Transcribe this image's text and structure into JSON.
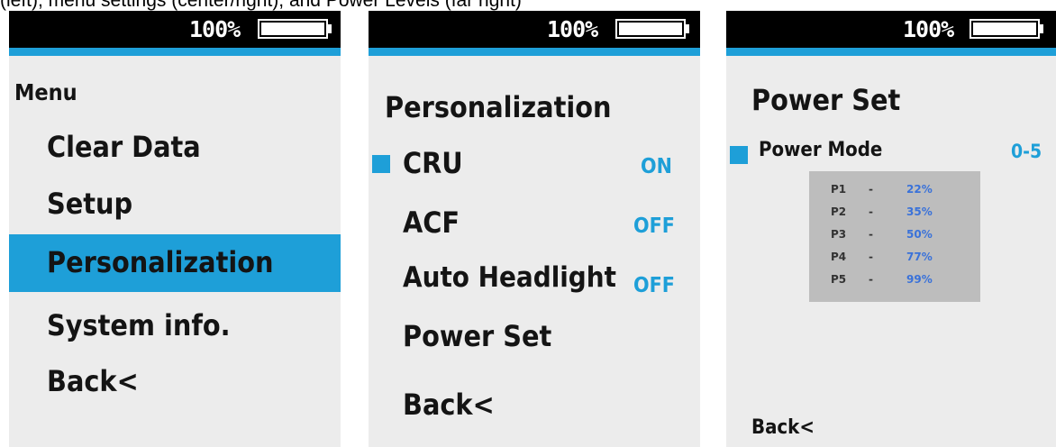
{
  "caption": "(left), menu settings (center/right), and Power Levels (far right)",
  "status": {
    "battery_text": "100%",
    "battery_level_pct": 100
  },
  "screen1": {
    "title": "Menu",
    "items": [
      {
        "label": "Clear Data",
        "selected": false
      },
      {
        "label": "Setup",
        "selected": false
      },
      {
        "label": "Personalization",
        "selected": true
      },
      {
        "label": "System info.",
        "selected": false
      },
      {
        "label": "Back<",
        "selected": false
      }
    ]
  },
  "screen2": {
    "title": "Personalization",
    "items": [
      {
        "label": "CRU",
        "value": "ON",
        "active": true
      },
      {
        "label": "ACF",
        "value": "OFF",
        "active": false
      },
      {
        "label": "Auto Headlight",
        "value": "OFF",
        "active": false
      },
      {
        "label": "Power Set",
        "value": "",
        "active": false
      },
      {
        "label": "Back<",
        "value": "",
        "active": false
      }
    ]
  },
  "screen3": {
    "title": "Power Set",
    "mode_label": "Power Mode",
    "mode_value": "0-5",
    "levels": [
      {
        "level": "P1",
        "dash": "-",
        "percent": "22%"
      },
      {
        "level": "P2",
        "dash": "-",
        "percent": "35%"
      },
      {
        "level": "P3",
        "dash": "-",
        "percent": "50%"
      },
      {
        "level": "P4",
        "dash": "-",
        "percent": "77%"
      },
      {
        "level": "P5",
        "dash": "-",
        "percent": "99%"
      }
    ],
    "back_label": "Back<"
  },
  "colors": {
    "accent": "#1e9fd8",
    "screen_bg": "#ececec",
    "statusbar": "#000000",
    "table_bg": "#bdbdbd"
  }
}
